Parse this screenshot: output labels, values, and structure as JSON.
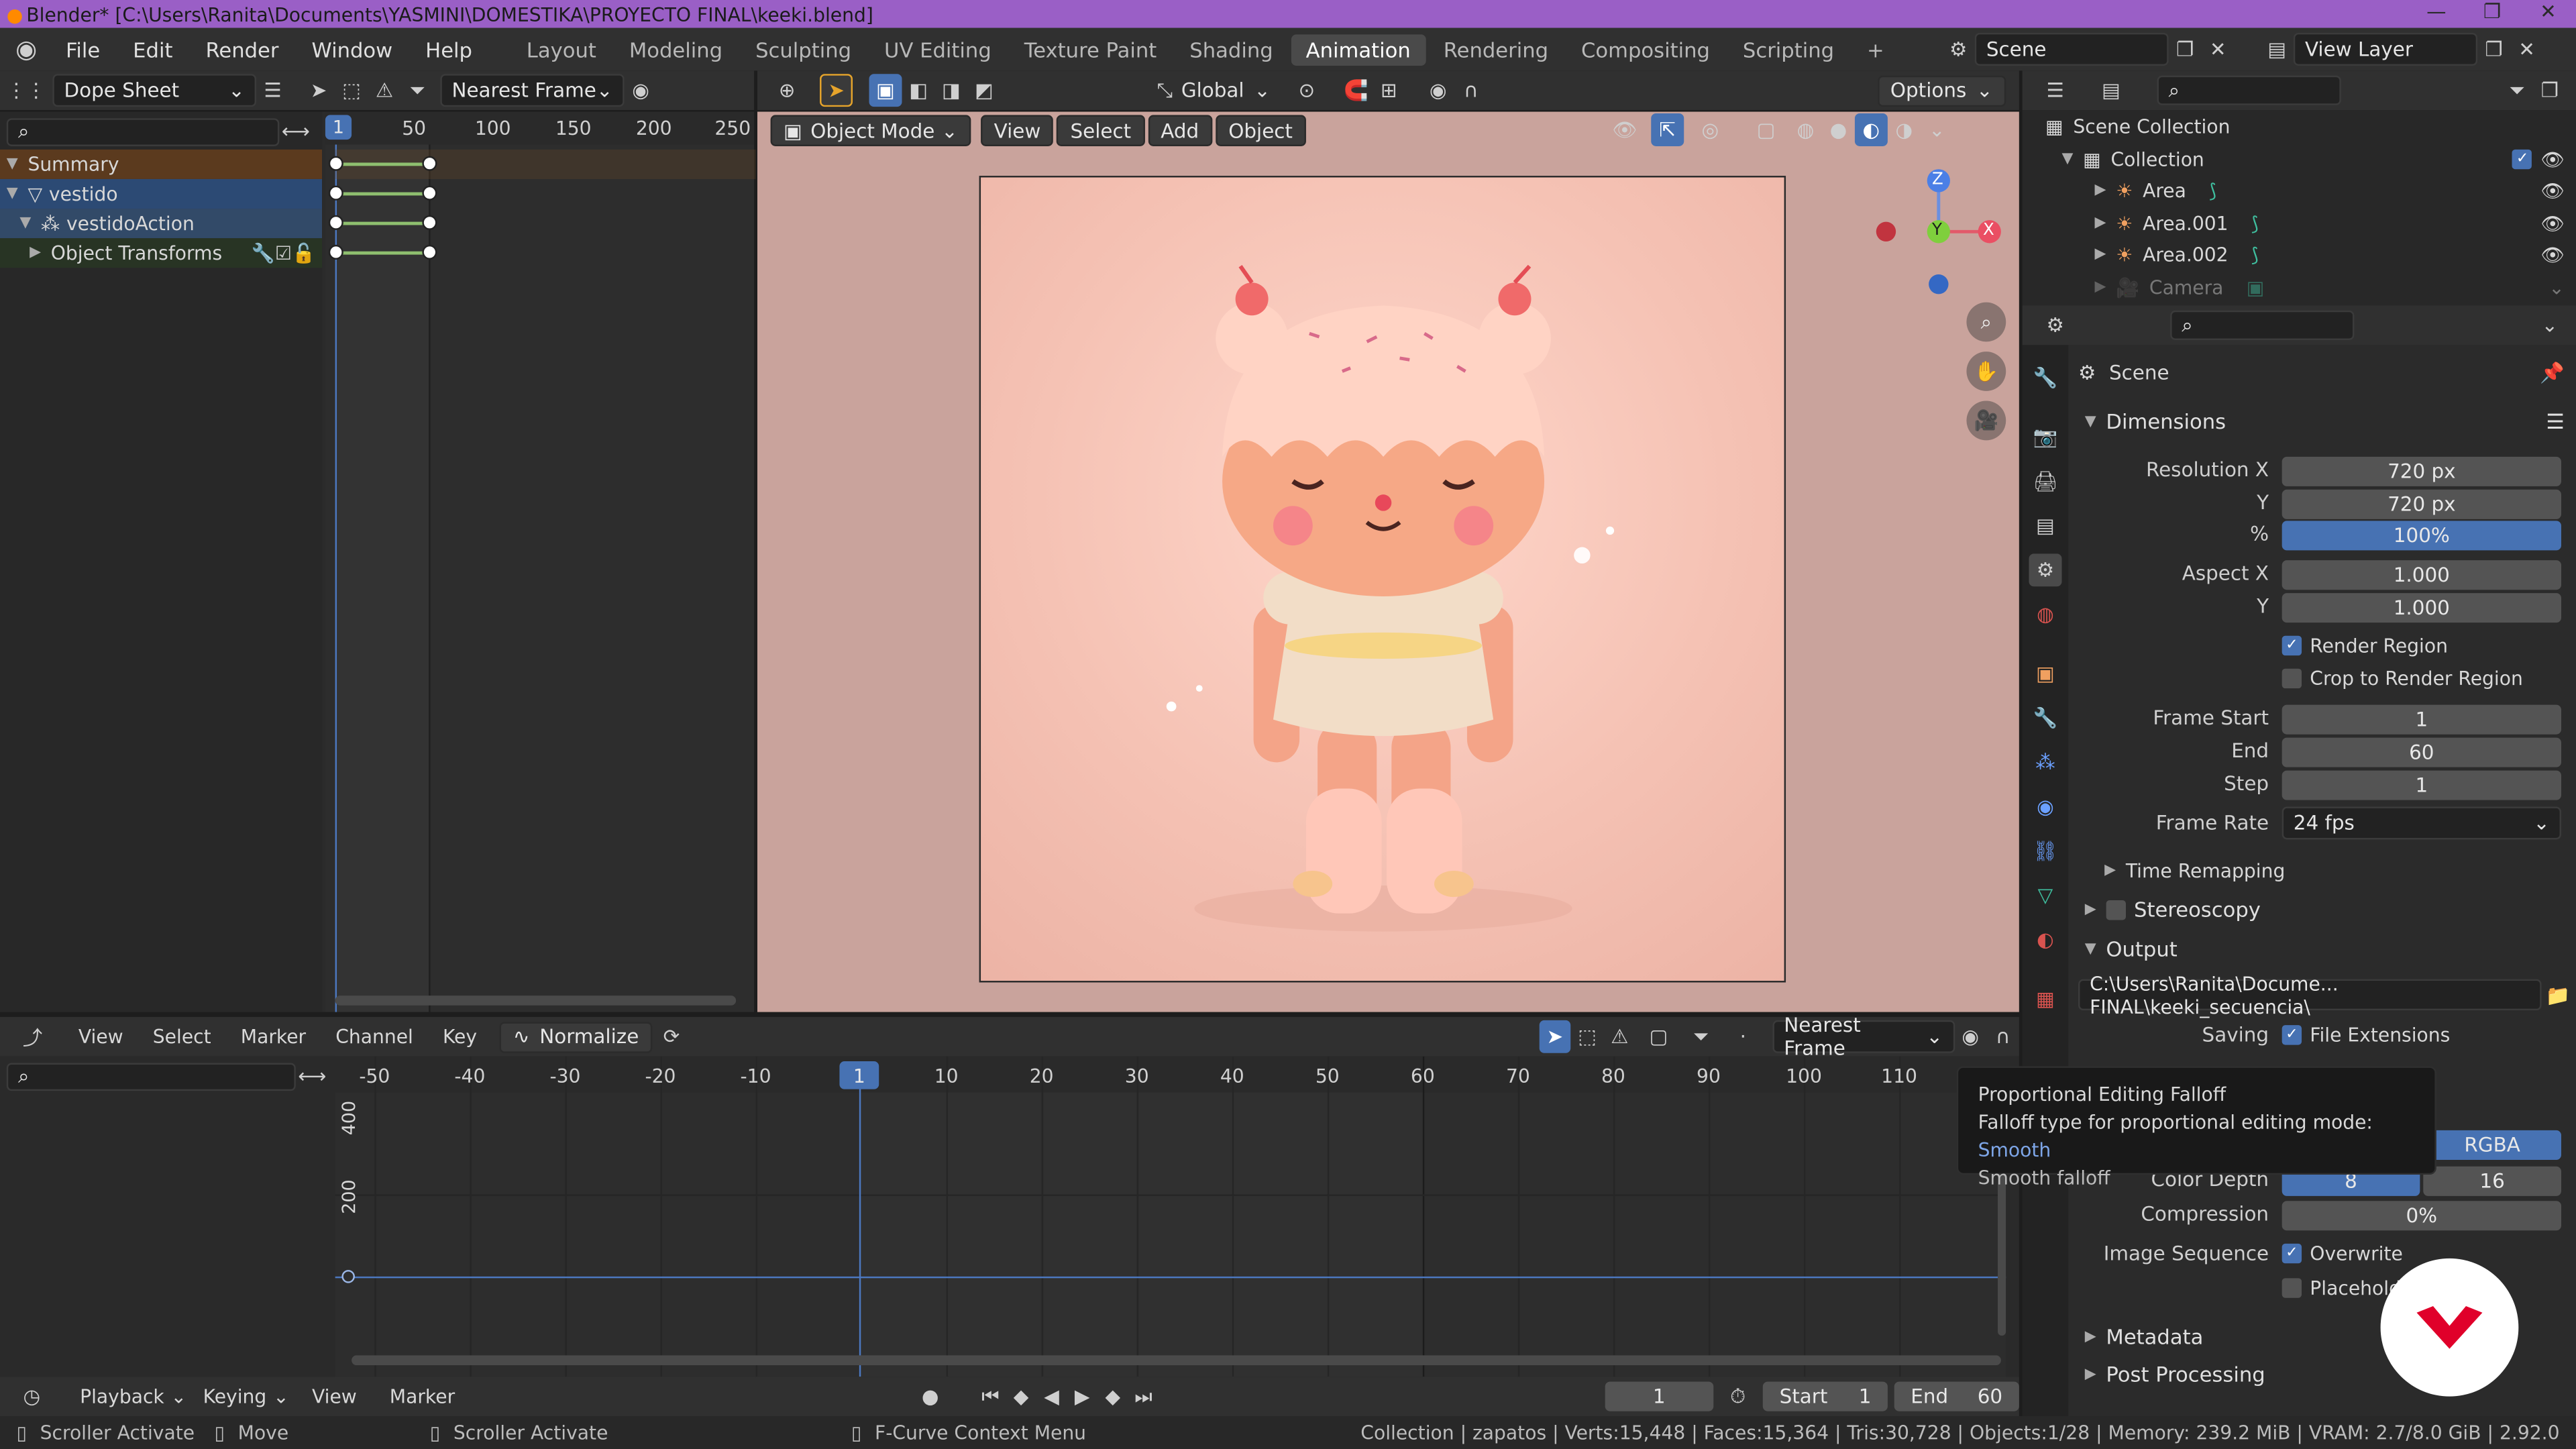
{
  "window": {
    "title": "Blender* [C:\\Users\\Ranita\\Documents\\YASMINI\\DOMESTIKA\\PROYECTO FINAL\\keeki.blend]"
  },
  "menu": [
    "File",
    "Edit",
    "Render",
    "Window",
    "Help"
  ],
  "workspaces": [
    {
      "label": "Layout"
    },
    {
      "label": "Modeling"
    },
    {
      "label": "Sculpting"
    },
    {
      "label": "UV Editing"
    },
    {
      "label": "Texture Paint"
    },
    {
      "label": "Shading"
    },
    {
      "label": "Animation",
      "active": true
    },
    {
      "label": "Rendering"
    },
    {
      "label": "Compositing"
    },
    {
      "label": "Scripting"
    }
  ],
  "scene": {
    "scene_name": "Scene",
    "view_layer": "View Layer"
  },
  "dopesheet": {
    "mode": "Dope Sheet",
    "snap": "Nearest Frame",
    "current_frame": "1",
    "ruler": [
      "50",
      "100",
      "150",
      "200",
      "250"
    ],
    "channels": [
      {
        "label": "Summary"
      },
      {
        "label": "vestido"
      },
      {
        "label": "vestidoAction"
      },
      {
        "label": "Object Transforms"
      }
    ]
  },
  "viewport": {
    "mode": "Object Mode",
    "menus": [
      "View",
      "Select",
      "Add",
      "Object"
    ],
    "orientation": "Global",
    "options": "Options",
    "gizmo": {
      "z": "Z",
      "y": "Y",
      "x": "X"
    }
  },
  "outliner": {
    "root": "Scene Collection",
    "collection": "Collection",
    "items": [
      "Area",
      "Area.001",
      "Area.002",
      "Camera"
    ]
  },
  "properties": {
    "context": "Scene",
    "sections": {
      "dimensions": "Dimensions",
      "time_remapping": "Time Remapping",
      "stereoscopy": "Stereoscopy",
      "output": "Output",
      "metadata": "Metadata",
      "post_processing": "Post Processing"
    },
    "resolution_x_label": "Resolution X",
    "resolution_x": "720 px",
    "y_label": "Y",
    "resolution_y": "720 px",
    "percent_label": "%",
    "percent": "100%",
    "aspect_x_label": "Aspect X",
    "aspect_x": "1.000",
    "aspect_y": "1.000",
    "render_region": "Render Region",
    "crop_region": "Crop to Render Region",
    "frame_start_label": "Frame Start",
    "frame_start": "1",
    "end_label": "End",
    "frame_end": "60",
    "step_label": "Step",
    "step": "1",
    "frame_rate_label": "Frame Rate",
    "frame_rate": "24 fps",
    "output_path": "C:\\Users\\Ranita\\Docume... FINAL\\keeki_secuencia\\",
    "saving_label": "Saving",
    "file_extensions": "File Extensions",
    "color_mode": "RGBA",
    "color_depth_label": "Color Depth",
    "depth_8": "8",
    "depth_16": "16",
    "compression_label": "Compression",
    "compression": "0%",
    "image_sequence_label": "Image Sequence",
    "overwrite": "Overwrite",
    "placeholders": "Placehold"
  },
  "graph": {
    "menus": [
      "View",
      "Select",
      "Marker",
      "Channel",
      "Key"
    ],
    "normalize": "Normalize",
    "snap": "Nearest Frame",
    "current_frame": "1",
    "ticks": [
      "-50",
      "-40",
      "-30",
      "-20",
      "-10",
      "10",
      "20",
      "30",
      "40",
      "50",
      "60",
      "70",
      "80",
      "90",
      "100",
      "110"
    ],
    "y_ticks": [
      "400",
      "200"
    ]
  },
  "tooltip": {
    "title": "Proportional Editing Falloff",
    "desc": "Falloff type for proportional editing mode:",
    "value": "Smooth",
    "footer": "Smooth falloff"
  },
  "timeline": {
    "playback": "Playback",
    "keying": "Keying",
    "view": "View",
    "marker": "Marker",
    "frame": "1",
    "start_label": "Start",
    "start": "1",
    "end_label": "End",
    "end": "60"
  },
  "statusbar": {
    "left1": "Scroller Activate",
    "left2": "Move",
    "mid": "Scroller Activate",
    "ctx": "F-Curve Context Menu",
    "stats": "Collection | zapatos | Verts:15,448 | Faces:15,364 | Tris:30,728 | Objects:1/28 | Memory: 239.2 MiB | VRAM: 2.7/8.0 GiB | 2.92.0"
  }
}
